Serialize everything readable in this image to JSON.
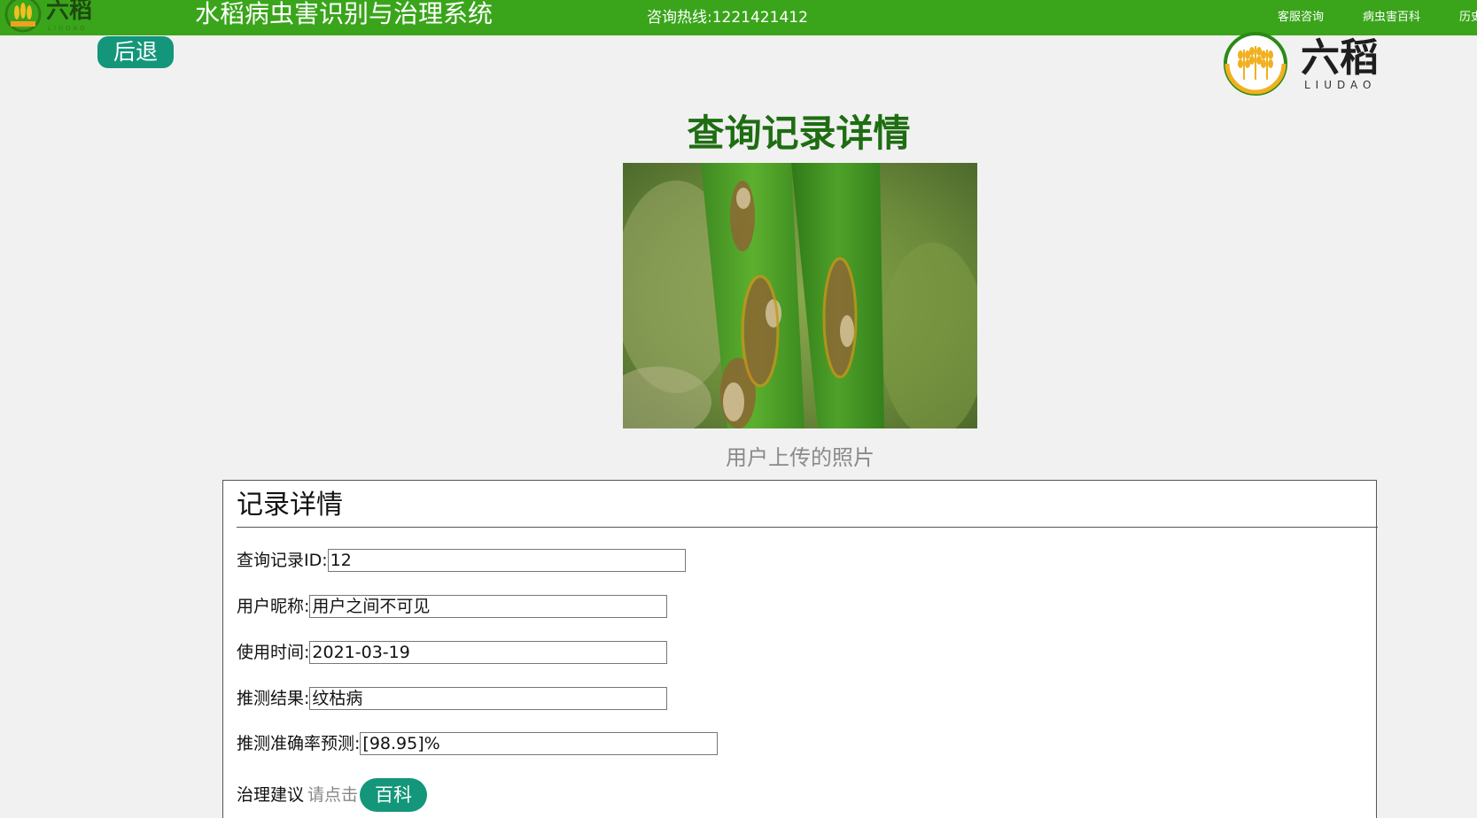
{
  "header": {
    "logo_text": "六稻",
    "logo_sub": "LIUDAO",
    "title": "水稻病虫害识别与治理系统",
    "hotline": "咨询热线:1221421412",
    "nav": [
      "客服咨询",
      "病虫害百科",
      "历史"
    ],
    "bg_color": "#3aa51b"
  },
  "back_label": "后退",
  "brand": {
    "logo_text": "六稻",
    "logo_sub": "LIUDAO",
    "icon": "rice-wheat-icon"
  },
  "page_title": "查询记录详情",
  "photo": {
    "caption": "用户上传的照片",
    "subject": "rice leaf with sheath blight lesions"
  },
  "detail": {
    "title": "记录详情",
    "fields": [
      {
        "label": "查询记录ID:",
        "value": "12"
      },
      {
        "label": "用户昵称:",
        "value": "用户之间不可见"
      },
      {
        "label": "使用时间:",
        "value": "2021-03-19"
      },
      {
        "label": "推测结果:",
        "value": "纹枯病"
      },
      {
        "label": "推测准确率预测:",
        "value": "[98.95]%"
      }
    ],
    "advice_label": "治理建议",
    "advice_hint": "请点击",
    "advice_button": "百科"
  },
  "colors": {
    "accent": "#14967a",
    "title_green": "#1e6d12"
  }
}
